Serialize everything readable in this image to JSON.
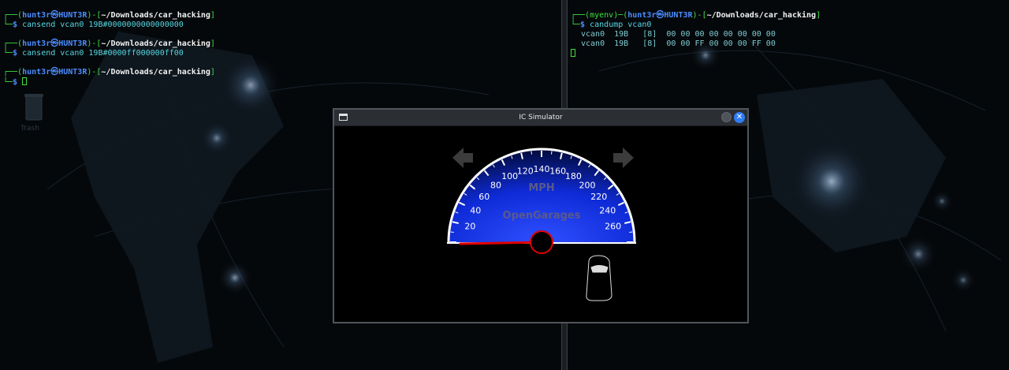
{
  "terminal_left": {
    "prompt": {
      "user": "hunt3r",
      "host": "HUNT3R",
      "path": "~/Downloads/car_hacking",
      "symbol": "$"
    },
    "commands": [
      "cansend vcan0 19B#0000000000000000",
      "cansend vcan0 19B#0000ff000000ff00"
    ]
  },
  "terminal_right": {
    "venv": "myenv",
    "prompt": {
      "user": "hunt3r",
      "host": "HUNT3R",
      "path": "~/Downloads/car_hacking",
      "symbol": "$"
    },
    "command": "candump vcan0",
    "output": [
      "vcan0  19B   [8]  00 00 00 00 00 00 00 00",
      "vcan0  19B   [8]  00 00 FF 00 00 00 FF 00"
    ]
  },
  "desktop": {
    "trash_label": "Trash"
  },
  "window": {
    "title": "IC Simulator",
    "close_glyph": "✕"
  },
  "dashboard": {
    "unit_label": "MPH",
    "brand_label": "OpenGarages",
    "ticks": [
      "20",
      "40",
      "60",
      "80",
      "100",
      "120",
      "140",
      "160",
      "180",
      "200",
      "220",
      "240",
      "260"
    ],
    "needle_speed": 0,
    "left_signal_on": false,
    "right_signal_on": false,
    "colors": {
      "needle": "#e00000",
      "gauge_center": "#1a3cff",
      "arrow": "#3c3c3c"
    }
  }
}
